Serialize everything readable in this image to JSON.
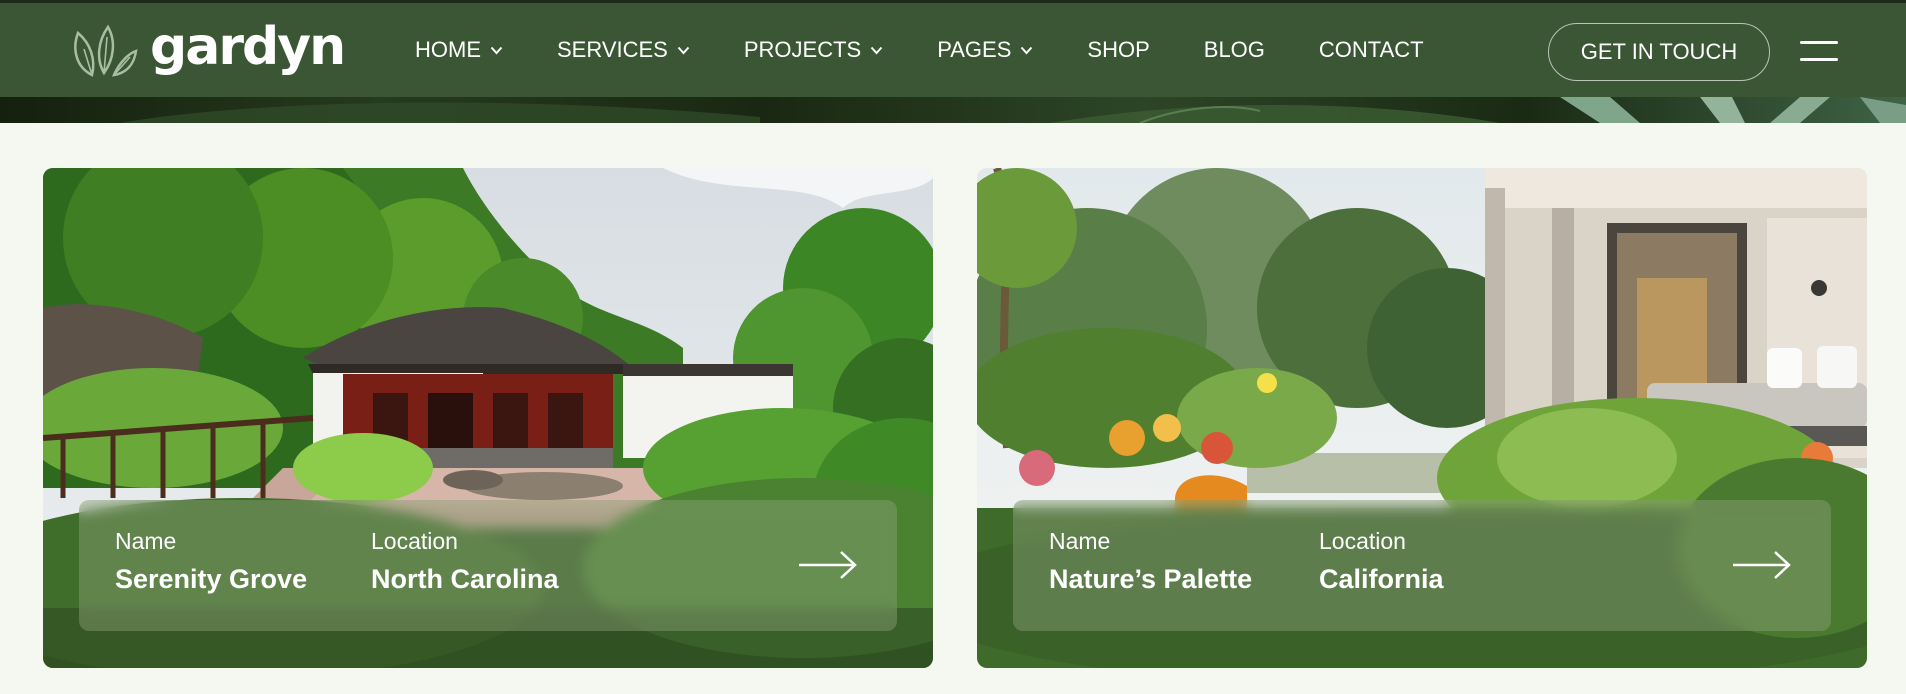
{
  "brand": {
    "name": "gardyn"
  },
  "nav": {
    "items": [
      {
        "label": "HOME",
        "dropdown": true
      },
      {
        "label": "SERVICES",
        "dropdown": true
      },
      {
        "label": "PROJECTS",
        "dropdown": true
      },
      {
        "label": "PAGES",
        "dropdown": true
      },
      {
        "label": "SHOP",
        "dropdown": false
      },
      {
        "label": "BLOG",
        "dropdown": false
      },
      {
        "label": "CONTACT",
        "dropdown": false
      }
    ],
    "cta_label": "GET IN TOUCH",
    "menu_icon": "hamburger-icon"
  },
  "projects": [
    {
      "name_label": "Name",
      "name": "Serenity Grove",
      "location_label": "Location",
      "location": "North Carolina",
      "image": "chinese-pavilion-garden-photo"
    },
    {
      "name_label": "Name",
      "name": "Nature’s Palette",
      "location_label": "Location",
      "location": "California",
      "image": "modern-house-garden-photo"
    }
  ],
  "colors": {
    "header_bg": "#3b5634",
    "page_bg": "#f5f8f1",
    "text_light": "#ffffff"
  }
}
